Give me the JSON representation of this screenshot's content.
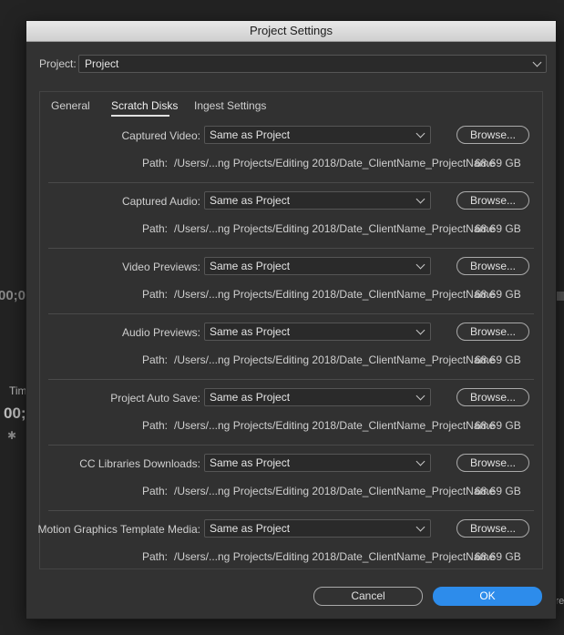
{
  "background": {
    "fragments": [
      "00;0",
      "Tim",
      "00;",
      "cre"
    ]
  },
  "dialog": {
    "title": "Project Settings",
    "project_label": "Project:",
    "project_value": "Project",
    "tabs": [
      {
        "label": "General",
        "active": false
      },
      {
        "label": "Scratch Disks",
        "active": true
      },
      {
        "label": "Ingest Settings",
        "active": false
      }
    ],
    "path_label": "Path:",
    "browse_label": "Browse...",
    "sections": [
      {
        "label": "Captured Video:",
        "value": "Same as Project",
        "path": "/Users/...ng Projects/Editing 2018/Date_ClientName_ProjectName",
        "size": "68.69 GB"
      },
      {
        "label": "Captured Audio:",
        "value": "Same as Project",
        "path": "/Users/...ng Projects/Editing 2018/Date_ClientName_ProjectName",
        "size": "68.69 GB"
      },
      {
        "label": "Video Previews:",
        "value": "Same as Project",
        "path": "/Users/...ng Projects/Editing 2018/Date_ClientName_ProjectName",
        "size": "68.69 GB"
      },
      {
        "label": "Audio Previews:",
        "value": "Same as Project",
        "path": "/Users/...ng Projects/Editing 2018/Date_ClientName_ProjectName",
        "size": "68.69 GB"
      },
      {
        "label": "Project Auto Save:",
        "value": "Same as Project",
        "path": "/Users/...ng Projects/Editing 2018/Date_ClientName_ProjectName",
        "size": "68.69 GB"
      },
      {
        "label": "CC Libraries Downloads:",
        "value": "Same as Project",
        "path": "/Users/...ng Projects/Editing 2018/Date_ClientName_ProjectName",
        "size": "68.69 GB"
      },
      {
        "label": "Motion Graphics Template Media:",
        "value": "Same as Project",
        "path": "/Users/...ng Projects/Editing 2018/Date_ClientName_ProjectName",
        "size": "68.69 GB"
      }
    ],
    "cancel_label": "Cancel",
    "ok_label": "OK",
    "colors": {
      "accent": "#2d8ceb",
      "dialog_bg": "#323232",
      "titlebar": "#dcdcdc"
    }
  }
}
